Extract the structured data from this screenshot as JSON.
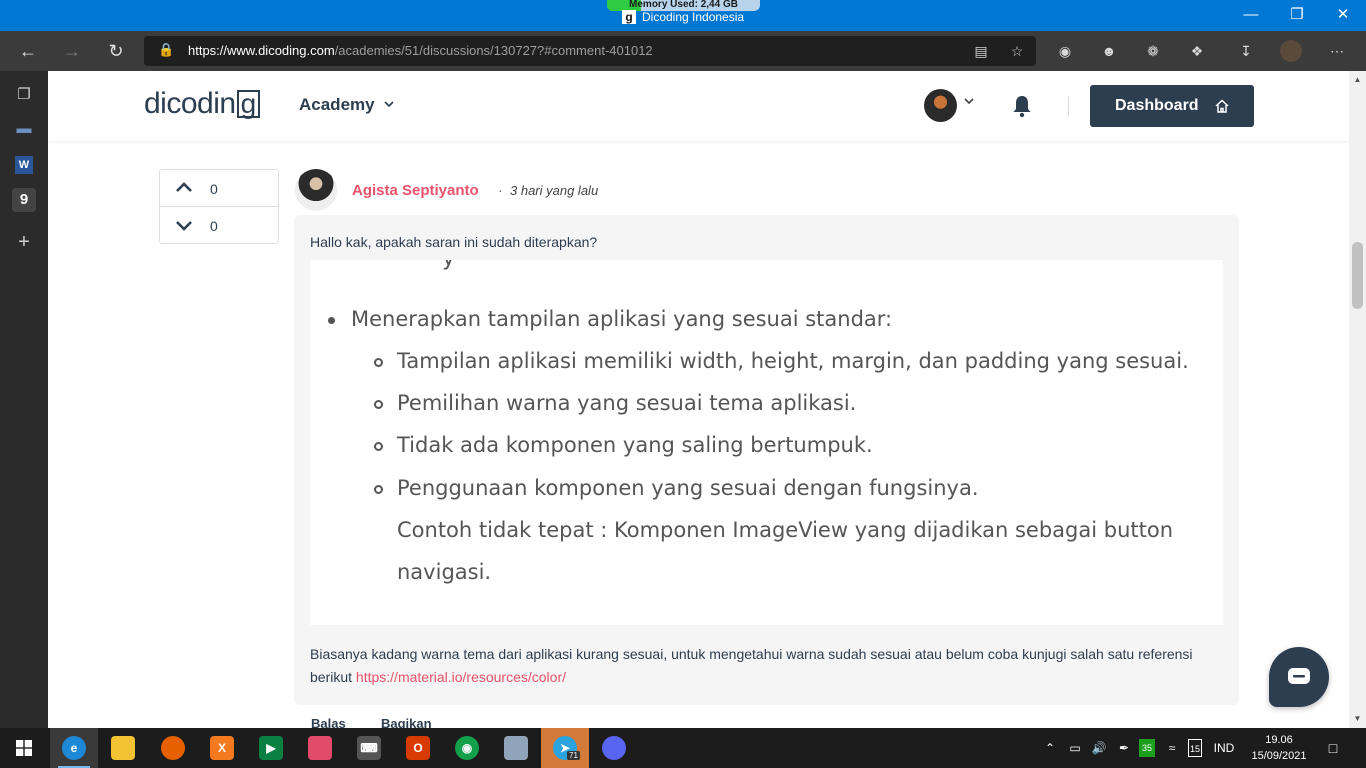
{
  "browser": {
    "memory_label": "Memory Used: 2,44 GB",
    "memory_fraction": 0.22,
    "tab_title": "Dicoding Indonesia",
    "url_host": "https://www.dicoding.com",
    "url_path": "/academies/51/discussions/130727?#comment-401012"
  },
  "site": {
    "brand": "dicodin",
    "brand_last": "g",
    "academy_menu": "Academy",
    "dashboard_label": "Dashboard"
  },
  "votes": {
    "up_count": "0",
    "down_count": "0"
  },
  "comment": {
    "author": "Agista Septiyanto",
    "separator": "·",
    "time": "3 hari yang lalu",
    "intro": "Hallo kak, apakah saran ini sudah diterapkan?",
    "quote": {
      "clipped_top": "y",
      "main_bullet": "Menerapkan tampilan aplikasi yang sesuai standar:",
      "sub_items": [
        "Tampilan aplikasi memiliki width, height, margin, dan padding yang sesuai.",
        "Pemilihan warna yang sesuai tema aplikasi.",
        "Tidak ada komponen yang saling bertumpuk.",
        "Penggunaan komponen yang sesuai dengan fungsinya."
      ],
      "sub_cont_1": "Contoh tidak tepat : Komponen ImageView yang dijadikan sebagai button",
      "sub_cont_2": "navigasi."
    },
    "body_text": "Biasanya kadang warna tema dari aplikasi kurang sesuai, untuk mengetahui warna sudah sesuai atau belum coba kunjugi salah satu referensi berikut ",
    "link_text": "https://material.io/resources/color/",
    "reply_label": "Balas",
    "share_label": "Bagikan"
  },
  "taskbar": {
    "telegram_badge": "71",
    "tray_badge": "35",
    "tray_date_badge": "15",
    "language": "IND",
    "time": "19.06",
    "date": "15/09/2021"
  },
  "colors": {
    "accent_pink": "#e8536b",
    "navy": "#2d3e50",
    "windows_blue": "#0078d4"
  }
}
